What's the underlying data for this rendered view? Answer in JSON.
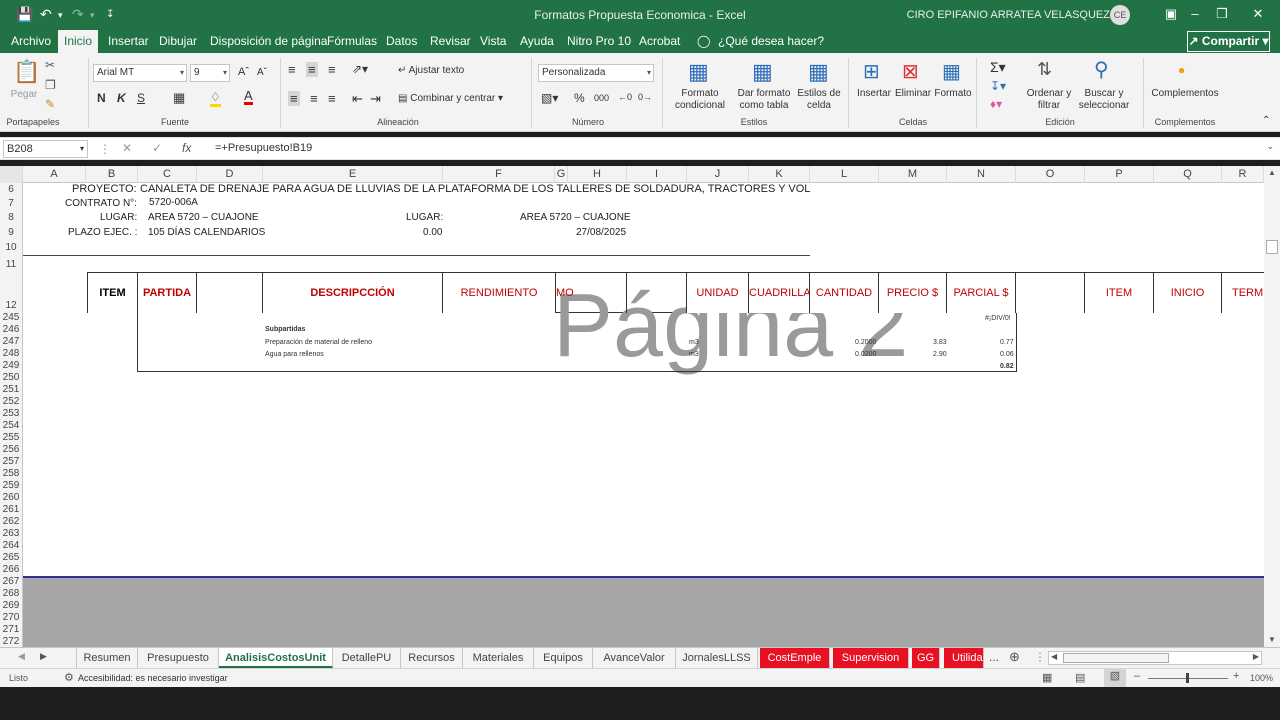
{
  "app": {
    "title": "Formatos Propuesta Economica  -  Excel",
    "user": "CIRO EPIFANIO ARRATEA VELASQUEZ",
    "initials": "CE"
  },
  "menu": {
    "tabs": [
      "Archivo",
      "Inicio",
      "Insertar",
      "Dibujar",
      "Disposición de página",
      "Fórmulas",
      "Datos",
      "Revisar",
      "Vista",
      "Ayuda",
      "Nitro Pro 10",
      "Acrobat"
    ],
    "tell_me": "¿Qué desea hacer?",
    "share": "Compartir"
  },
  "ribbon": {
    "clipboard": {
      "label": "Portapapeles",
      "paste": "Pegar"
    },
    "font": {
      "label": "Fuente",
      "name": "Arial MT",
      "size": "9"
    },
    "alignment": {
      "label": "Alineación",
      "wrap": "Ajustar texto",
      "merge": "Combinar y centrar"
    },
    "number": {
      "label": "Número",
      "format": "Personalizada"
    },
    "styles": {
      "label": "Estilos",
      "conditional": "Formato condicional",
      "as_table": "Dar formato como tabla",
      "cell_styles": "Estilos de celda"
    },
    "cells": {
      "label": "Celdas",
      "insert": "Insertar",
      "delete": "Eliminar",
      "format": "Formato"
    },
    "editing": {
      "label": "Edición",
      "sort": "Ordenar y filtrar",
      "find": "Buscar y seleccionar"
    },
    "addins": {
      "label": "Complementos",
      "button": "Complementos"
    }
  },
  "formula_bar": {
    "name_box": "B208",
    "formula": "=+Presupuesto!B19"
  },
  "columns": [
    "A",
    "B",
    "C",
    "D",
    "E",
    "F",
    "G",
    "H",
    "I",
    "J",
    "K",
    "L",
    "M",
    "N",
    "O",
    "P",
    "Q",
    "R"
  ],
  "rows": [
    "6",
    "7",
    "8",
    "9",
    "10",
    "11",
    "12",
    "245",
    "246",
    "247",
    "248",
    "249",
    "250",
    "251",
    "252",
    "253",
    "254",
    "255",
    "256",
    "257",
    "258",
    "259",
    "260",
    "261",
    "262",
    "263",
    "264",
    "265",
    "266",
    "267",
    "268",
    "269",
    "270",
    "271",
    "272"
  ],
  "project": {
    "proyecto_label": "PROYECTO:",
    "proyecto_value": "CANALETA DE DRENAJE PARA AGUA DE LLUVIAS DE LA PLATAFORMA DE LOS TALLERES DE SOLDADURA, TRACTORES Y VOL",
    "contrato_label": "CONTRATO N°:",
    "contrato_value": "5720-006A",
    "lugar_label": "LUGAR:",
    "lugar_value": "AREA 5720 – CUAJONE",
    "lugar_label2": "LUGAR:",
    "lugar_value2": "AREA 5720 – CUAJONE",
    "plazo_label": "PLAZO EJEC. :",
    "plazo_value": "105 DÍAS CALENDARIOS",
    "plazo_num": "0.00",
    "fecha": "27/08/2025"
  },
  "table_headers": [
    "ITEM",
    "PARTIDA",
    "DESCRIPCCIÓN",
    "RENDIMIENTO",
    "MO",
    "UNIDAD",
    "CUADRILLA",
    "CANTIDAD",
    "PRECIO $",
    "PARCIAL $",
    "ITEM",
    "INICIO",
    "TERM"
  ],
  "watermark": "Página 2",
  "subpartidas": {
    "error": "#¡DIV/0!",
    "title": "Subpartidas",
    "rows": [
      {
        "desc": "Preparación de material de relleno",
        "unit": "m3",
        "cant": "0.2000",
        "precio": "3.83",
        "parcial": "0.77"
      },
      {
        "desc": "Agua para rellenos",
        "unit": "m3",
        "cant": "0.0200",
        "precio": "2.90",
        "parcial": "0.06"
      }
    ],
    "total": "0.82"
  },
  "sheets": [
    "Resumen",
    "Presupuesto",
    "AnalisisCostosUnit",
    "DetallePU",
    "Recursos",
    "Materiales",
    "Equipos",
    "AvanceValor",
    "JornalesLLSS",
    "CostEmple",
    "Supervision",
    "GG",
    "Utilida"
  ],
  "status": {
    "mode": "Listo",
    "accessibility": "Accesibilidad: es necesario investigar",
    "zoom": "100%"
  },
  "colors": {
    "excel_green": "#217346",
    "header_red": "#c00000",
    "sheet_red": "#e81123"
  }
}
